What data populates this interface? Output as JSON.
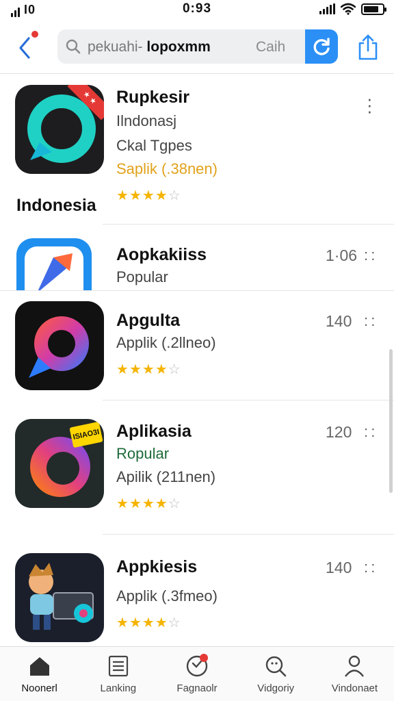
{
  "status_bar": {
    "carrier": "I0",
    "time": "0:93"
  },
  "header": {
    "search_query_light": "pekuahi-",
    "search_query_bold": "lopoxmm",
    "search_hint": "Caih",
    "icons": {
      "back": "back-chevron-icon",
      "search": "search-icon",
      "refresh": "refresh-icon",
      "share": "share-icon"
    },
    "accent_color": "#2b8ff6"
  },
  "section_label": "Indonesia",
  "apps": [
    {
      "name": "Rupkesir",
      "line1": "Ilndonasj",
      "line2": "Ckal Tgpes",
      "line3": "Saplik (.38nen)",
      "rating": 4,
      "rating_max": 5,
      "count": "",
      "corner_badge": ""
    },
    {
      "name": "Aopkakiiss",
      "line1": "Popular",
      "count": "1·06",
      "rating": 0,
      "rating_max": 5
    },
    {
      "name": "Apgulta",
      "line1": "Applik (.2llneo)",
      "count": "140",
      "rating": 4,
      "rating_max": 5
    },
    {
      "name": "Aplikasia",
      "line1": "Ropular",
      "line2": "Apilik (211nen)",
      "count": "120",
      "rating": 4,
      "rating_max": 5,
      "tag": "ISIAO3I"
    },
    {
      "name": "Appkiesis",
      "line1": "Applik (.3fmeo)",
      "count": "140",
      "rating": 4,
      "rating_max": 5
    }
  ],
  "tabs": [
    {
      "label": "Noonerl",
      "icon": "home-icon"
    },
    {
      "label": "Lanking",
      "icon": "list-icon"
    },
    {
      "label": "Fagnaolr",
      "icon": "chevron-circle-icon"
    },
    {
      "label": "Vidgoriy",
      "icon": "search-person-icon"
    },
    {
      "label": "Vindonaet",
      "icon": "profile-icon"
    }
  ],
  "colors": {
    "star": "#f5b400",
    "badge": "#e53935",
    "green_text": "#1e6b3a",
    "orange_text": "#e0a21a"
  }
}
